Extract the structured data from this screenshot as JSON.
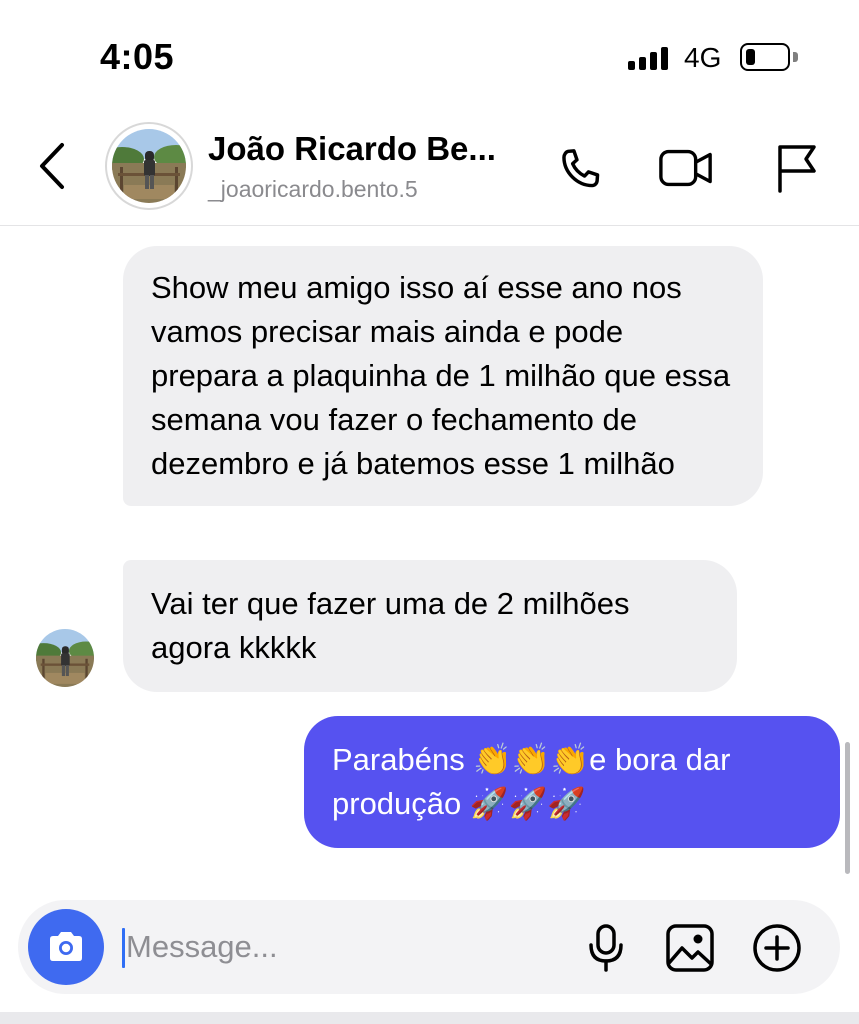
{
  "status_bar": {
    "time": "4:05",
    "network": "4G",
    "battery_level": 0.25
  },
  "header": {
    "contact_name": "João Ricardo Be...",
    "contact_username": "_joaoricardo.bento.5",
    "icons": {
      "back": "chevron-left-icon",
      "call": "phone-icon",
      "video": "video-camera-icon",
      "report": "flag-icon"
    }
  },
  "messages": [
    {
      "direction": "incoming",
      "text": "Show meu amigo isso aí esse ano nos vamos precisar mais ainda e pode prepara a plaquinha de 1 milhão que essa semana vou fazer o fechamento de dezembro e já batemos esse 1 milhão"
    },
    {
      "direction": "incoming",
      "text": "Vai ter que fazer uma de 2 milhões agora kkkkk"
    },
    {
      "direction": "outgoing",
      "text": "Parabéns 👏👏👏e bora dar produção 🚀🚀🚀"
    }
  ],
  "composer": {
    "placeholder": "Message...",
    "icons": {
      "camera": "camera-icon",
      "mic": "microphone-icon",
      "gallery": "image-icon",
      "more": "plus-circle-icon"
    }
  },
  "colors": {
    "outgoing_bubble": "#5652f0",
    "incoming_bubble": "#efeff1",
    "camera_button": "#3f6af0",
    "caret": "#2f6ef5"
  }
}
